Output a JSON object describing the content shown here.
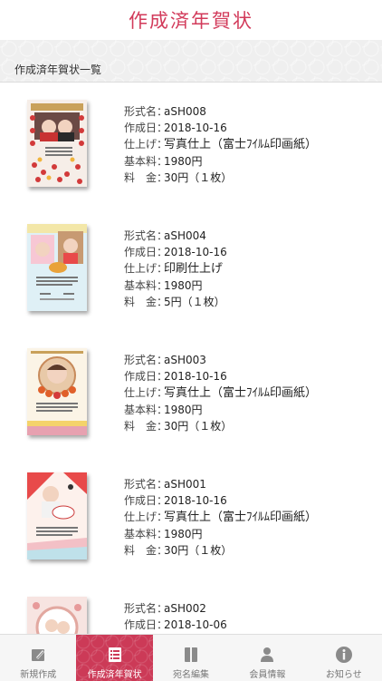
{
  "header": {
    "title": "作成済年賀状"
  },
  "section": {
    "title": "作成済年賀状一覧"
  },
  "labels": {
    "format": "形式名：",
    "date": "作成日：",
    "finish": "仕上げ：",
    "base_fee": "基本料：",
    "fee": "料　金："
  },
  "items": [
    {
      "format": "aSH008",
      "date": "2018-10-16",
      "finish": "写真仕上（富士ﾌｲﾙﾑ印画紙）",
      "base_fee": "1980円",
      "fee": "30円（１枚）"
    },
    {
      "format": "aSH004",
      "date": "2018-10-16",
      "finish": "印刷仕上げ",
      "base_fee": "1980円",
      "fee": "5円（１枚）"
    },
    {
      "format": "aSH003",
      "date": "2018-10-16",
      "finish": "写真仕上（富士ﾌｲﾙﾑ印画紙）",
      "base_fee": "1980円",
      "fee": "30円（１枚）"
    },
    {
      "format": "aSH001",
      "date": "2018-10-16",
      "finish": "写真仕上（富士ﾌｲﾙﾑ印画紙）",
      "base_fee": "1980円",
      "fee": "30円（１枚）"
    },
    {
      "format": "aSH002",
      "date": "2018-10-06"
    }
  ],
  "tabs": [
    {
      "label": "新規作成",
      "icon": "pencil-icon"
    },
    {
      "label": "作成済年賀状",
      "icon": "list-icon",
      "active": true
    },
    {
      "label": "宛名編集",
      "icon": "address-book-icon"
    },
    {
      "label": "会員情報",
      "icon": "person-icon"
    },
    {
      "label": "お知らせ",
      "icon": "info-icon"
    }
  ],
  "colors": {
    "accent": "#cc3a57",
    "title": "#d23a5a"
  }
}
